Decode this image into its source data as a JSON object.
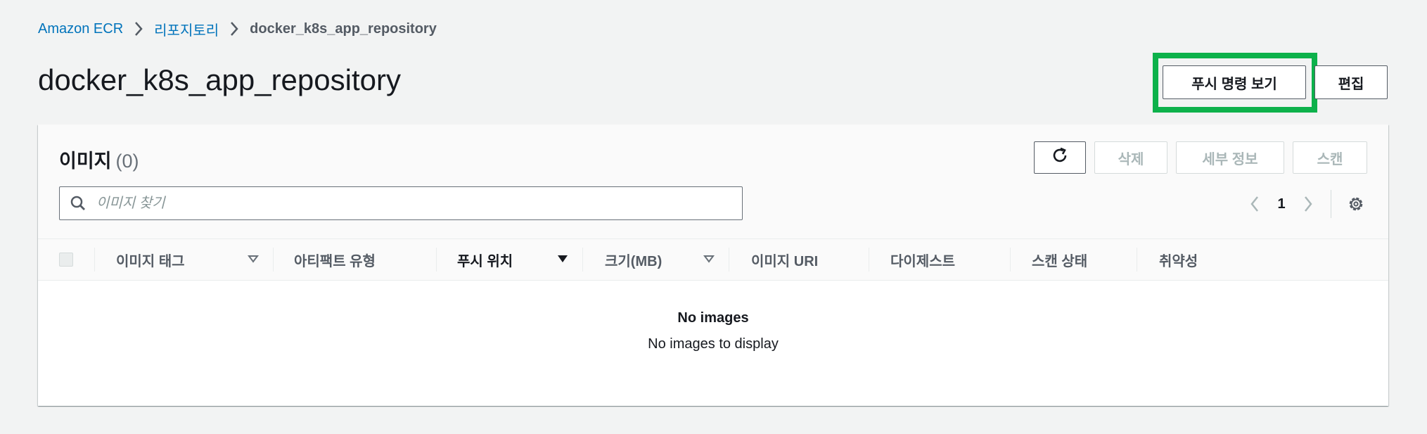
{
  "breadcrumb": {
    "items": [
      "Amazon ECR",
      "리포지토리",
      "docker_k8s_app_repository"
    ]
  },
  "page": {
    "title": "docker_k8s_app_repository",
    "push_commands_label": "푸시 명령 보기",
    "edit_label": "편집"
  },
  "panel": {
    "title": "이미지",
    "count": "(0)",
    "delete_label": "삭제",
    "details_label": "세부 정보",
    "scan_label": "스캔",
    "search_placeholder": "이미지 찾기",
    "page_number": "1"
  },
  "table": {
    "columns": [
      "이미지 태그",
      "아티팩트 유형",
      "푸시 위치",
      "크기(MB)",
      "이미지 URI",
      "다이제스트",
      "스캔 상태",
      "취약성"
    ]
  },
  "empty_state": {
    "title": "No images",
    "description": "No images to display"
  },
  "colors": {
    "link": "#0073bb",
    "highlight": "#0db14b",
    "background": "#f2f3f3"
  },
  "icons": [
    "chevron-right-icon",
    "refresh-icon",
    "search-icon",
    "chevron-left-icon",
    "settings-gear-icon",
    "sort-down-icon"
  ]
}
